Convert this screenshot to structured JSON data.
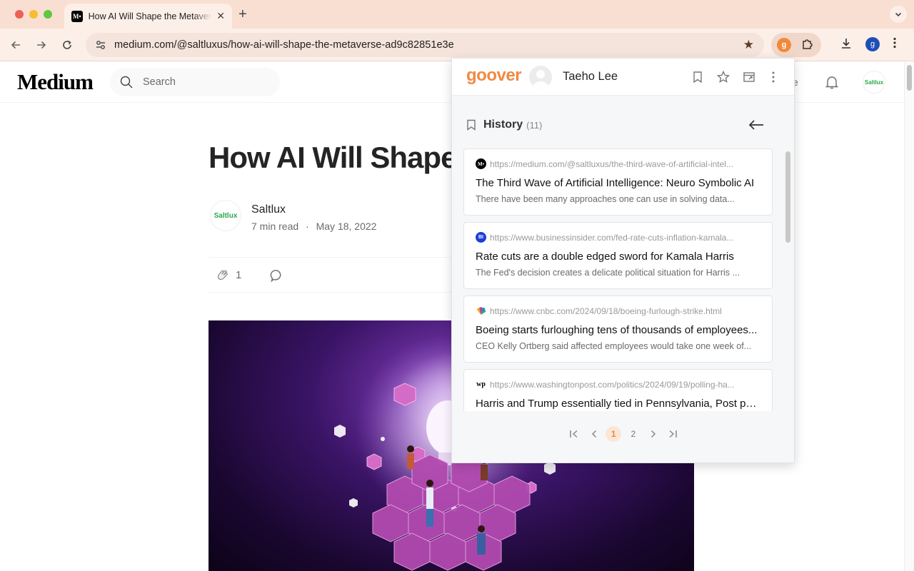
{
  "browser": {
    "tab_title": "How AI Will Shape the Metaverse",
    "tab_favicon": "M•",
    "new_tab": "+",
    "url": "medium.com/@saltluxus/how-ai-will-shape-the-metaverse-ad9c82851e3e",
    "profile_initial": "g",
    "extension_badge": "g",
    "colors": {
      "tabstrip": "#f9dfd1",
      "toolbar": "#fcefe8"
    }
  },
  "medium": {
    "logo": "Medium",
    "search_placeholder": "Search",
    "write_label": "e",
    "avatar_text": "Saltlux",
    "article": {
      "title": "How AI Will Shape",
      "author": "Saltlux",
      "author_avatar_text": "Saltlux",
      "read_time": "7 min read",
      "separator": "·",
      "date": "May 18, 2022",
      "claps": "1"
    }
  },
  "goover": {
    "logo": "goover",
    "user_name": "Taeho Lee",
    "history_title": "History",
    "history_count": "(11)",
    "items": [
      {
        "favicon": "M•",
        "favicon_color": "#000000",
        "url": "https://medium.com/@saltluxus/the-third-wave-of-artificial-intel...",
        "title": "The Third Wave of Artificial Intelligence: Neuro Symbolic AI",
        "desc": "There have been many approaches one can use in solving data..."
      },
      {
        "favicon": "BI",
        "favicon_color": "#1c3fd6",
        "url": "https://www.businessinsider.com/fed-rate-cuts-inflation-kamala...",
        "title": "Rate cuts are a double edged sword for Kamala Harris",
        "desc": "The Fed's decision creates a delicate political situation for Harris ..."
      },
      {
        "favicon": "",
        "favicon_color": "#ffffff",
        "url": "https://www.cnbc.com/2024/09/18/boeing-furlough-strike.html",
        "title": "Boeing starts furloughing tens of thousands of employees...",
        "desc": "CEO Kelly Ortberg said affected employees would take one week of..."
      },
      {
        "favicon": "wp",
        "favicon_color": "#ffffff",
        "url": "https://www.washingtonpost.com/politics/2024/09/19/polling-ha...",
        "title": "Harris and Trump essentially tied in Pennsylvania, Post pol...",
        "desc": ""
      }
    ],
    "pagination": {
      "current": "1",
      "pages": [
        "1",
        "2"
      ],
      "current_page": 1,
      "total_pages": 2
    }
  }
}
